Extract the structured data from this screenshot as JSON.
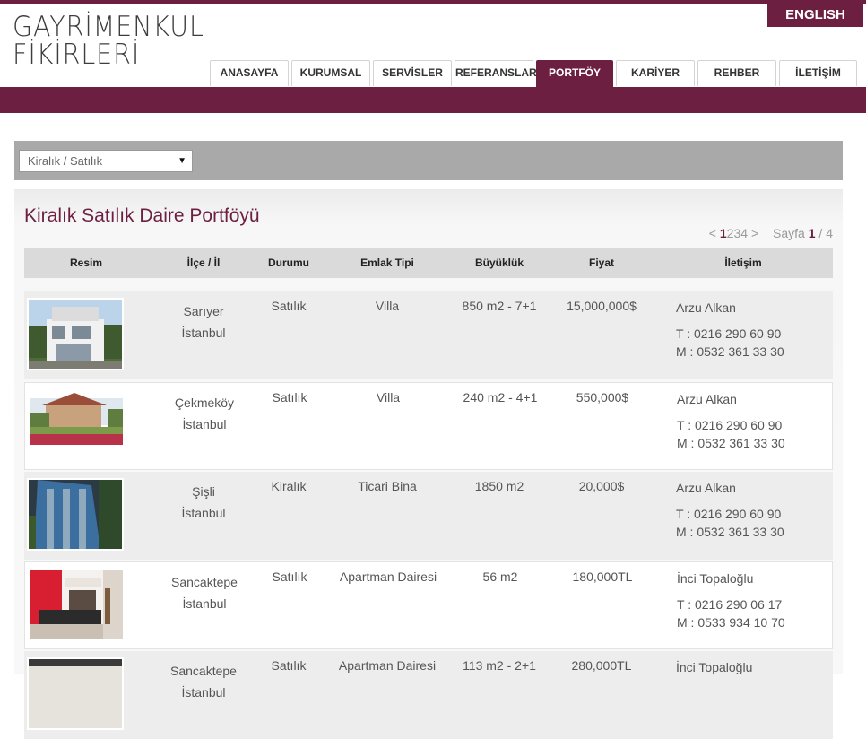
{
  "header": {
    "logo_line1": "GAYRİMENKUL",
    "logo_line2": "FİKİRLERİ",
    "lang_button": "ENGLISH"
  },
  "nav": [
    {
      "label": "ANASAYFA",
      "active": false
    },
    {
      "label": "KURUMSAL",
      "active": false
    },
    {
      "label": "SERVİSLER",
      "active": false
    },
    {
      "label": "REFERANSLAR",
      "active": false
    },
    {
      "label": "PORTFÖY",
      "active": true
    },
    {
      "label": "KARİYER",
      "active": false
    },
    {
      "label": "REHBER",
      "active": false
    },
    {
      "label": "İLETİŞİM",
      "active": false
    }
  ],
  "filter": {
    "selected": "Kiralık / Satılık",
    "caret_icon": "chevron-down-icon"
  },
  "portfolio": {
    "title": "Kiralık Satılık Daire Portföyü",
    "pager": {
      "prev": "<",
      "pages": [
        "1",
        "2",
        "3",
        "4"
      ],
      "current_page": 1,
      "next": ">",
      "page_label": "Sayfa",
      "current": "1",
      "separator": "/",
      "total": "4"
    },
    "columns": {
      "image": "Resim",
      "location": "İlçe / İl",
      "status": "Durumu",
      "type": "Emlak Tipi",
      "size": "Büyüklük",
      "price": "Fiyat",
      "contact": "İletişim"
    },
    "rows": [
      {
        "district": "Sarıyer",
        "city": "İstanbul",
        "status": "Satılık",
        "type": "Villa",
        "size": "850 m2 - 7+1",
        "price": "15,000,000$",
        "agent": "Arzu Alkan",
        "phone": "T : 0216 290 60 90",
        "mobile": "M : 0532 361 33 30"
      },
      {
        "district": "Çekmeköy",
        "city": "İstanbul",
        "status": "Satılık",
        "type": "Villa",
        "size": "240 m2 - 4+1",
        "price": "550,000$",
        "agent": "Arzu Alkan",
        "phone": "T : 0216 290 60 90",
        "mobile": "M : 0532 361 33 30"
      },
      {
        "district": "Şişli",
        "city": "İstanbul",
        "status": "Kiralık",
        "type": "Ticari Bina",
        "size": "1850 m2",
        "price": "20,000$",
        "agent": "Arzu Alkan",
        "phone": "T : 0216 290 60 90",
        "mobile": "M : 0532 361 33 30"
      },
      {
        "district": "Sancaktepe",
        "city": "İstanbul",
        "status": "Satılık",
        "type": "Apartman Dairesi",
        "size": "56 m2",
        "price": "180,000TL",
        "agent": "İnci Topaloğlu",
        "phone": "T : 0216 290 06 17",
        "mobile": "M : 0533 934 10 70"
      },
      {
        "district": "Sancaktepe",
        "city": "İstanbul",
        "status": "Satılık",
        "type": "Apartman Dairesi",
        "size": "113 m2 - 2+1",
        "price": "280,000TL",
        "agent": "İnci Topaloğlu",
        "phone": "",
        "mobile": ""
      }
    ]
  }
}
